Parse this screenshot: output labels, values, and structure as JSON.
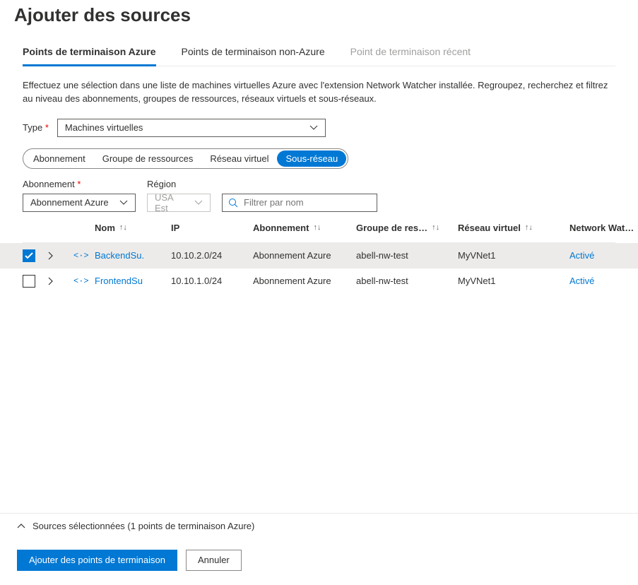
{
  "title": "Ajouter des sources",
  "tabs": {
    "azure": "Points de terminaison Azure",
    "nonazure": "Points de terminaison non-Azure",
    "recent": "Point de terminaison récent"
  },
  "description": "Effectuez une sélection dans une liste de machines virtuelles Azure avec l'extension Network Watcher installée. Regroupez, recherchez et filtrez au niveau des abonnements, groupes de ressources, réseaux virtuels et sous-réseaux.",
  "typeLabel": "Type",
  "typeValue": "Machines virtuelles",
  "pills": {
    "subscription": "Abonnement",
    "rg": "Groupe de ressources",
    "vnet": "Réseau virtuel",
    "subnet": "Sous-réseau"
  },
  "filters": {
    "subscriptionLabel": "Abonnement",
    "subscriptionValue": "Abonnement Azure",
    "regionLabel": "Région",
    "regionValue": "USA Est",
    "searchPlaceholder": "Filtrer par nom"
  },
  "columns": {
    "name": "Nom",
    "ip": "IP",
    "subscription": "Abonnement",
    "rg": "Groupe de res…",
    "vnet": "Réseau virtuel",
    "nw": "Network Wat…"
  },
  "rows": [
    {
      "checked": true,
      "name": "BackendSu.",
      "ip": "10.10.2.0/24",
      "subscription": "Abonnement Azure",
      "rg": "abell-nw-test",
      "vnet": "MyVNet1",
      "nw": "Activé"
    },
    {
      "checked": false,
      "name": "FrontendSu",
      "ip": "10.10.1.0/24",
      "subscription": "Abonnement Azure",
      "rg": "abell-nw-test",
      "vnet": "MyVNet1",
      "nw": "Activé"
    }
  ],
  "selectedBar": "Sources sélectionnées (1 points de terminaison Azure)",
  "buttons": {
    "add": "Ajouter des points de terminaison",
    "cancel": "Annuler"
  }
}
